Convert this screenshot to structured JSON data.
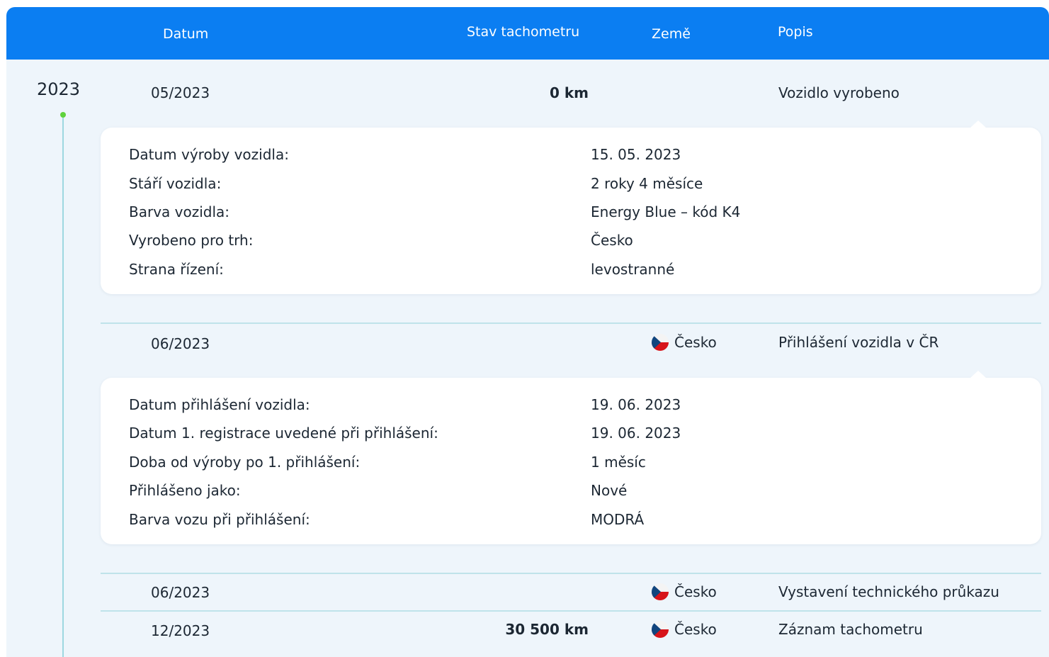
{
  "header": {
    "date": "Datum",
    "odometer": "Stav tachometru",
    "country": "Země",
    "description": "Popis"
  },
  "timeline": {
    "year": "2023",
    "events": [
      {
        "date": "05/2023",
        "odometer": "0 km",
        "country": "",
        "description": "Vozidlo vyrobeno",
        "details": [
          {
            "label": "Datum výroby vozidla:",
            "value": "15. 05. 2023"
          },
          {
            "label": "Stáří vozidla:",
            "value": "2 roky 4 měsíce"
          },
          {
            "label": "Barva vozidla:",
            "value": "Energy Blue – kód K4"
          },
          {
            "label": "Vyrobeno pro trh:",
            "value": "Česko"
          },
          {
            "label": "Strana řízení:",
            "value": "levostranné"
          }
        ]
      },
      {
        "date": "06/2023",
        "odometer": "",
        "country": "Česko",
        "description": "Přihlášení vozidla v ČR",
        "details": [
          {
            "label": "Datum přihlášení vozidla:",
            "value": "19. 06. 2023"
          },
          {
            "label": "Datum 1. registrace uvedené při přihlášení:",
            "value": "19. 06. 2023"
          },
          {
            "label": "Doba od výroby po 1. přihlášení:",
            "value": "1 měsíc"
          },
          {
            "label": "Přihlášeno jako:",
            "value": "Nové"
          },
          {
            "label": "Barva vozu při přihlášení:",
            "value": "MODRÁ"
          }
        ]
      },
      {
        "date": "06/2023",
        "odometer": "",
        "country": "Česko",
        "description": "Vystavení technického průkazu"
      },
      {
        "date": "12/2023",
        "odometer": "30 500 km",
        "country": "Česko",
        "description": "Záznam tachometru"
      }
    ]
  },
  "icons": {
    "flag": "czech-flag-icon",
    "timeline_marker": "green-dot"
  },
  "colors": {
    "header": "#0b7ef2",
    "background": "#eef5fb",
    "card": "#ffffff",
    "separator": "#bfe3ea",
    "timeline_dot": "#5fd23c",
    "timeline_line": "#9ed8e0",
    "text": "#1c2733"
  }
}
